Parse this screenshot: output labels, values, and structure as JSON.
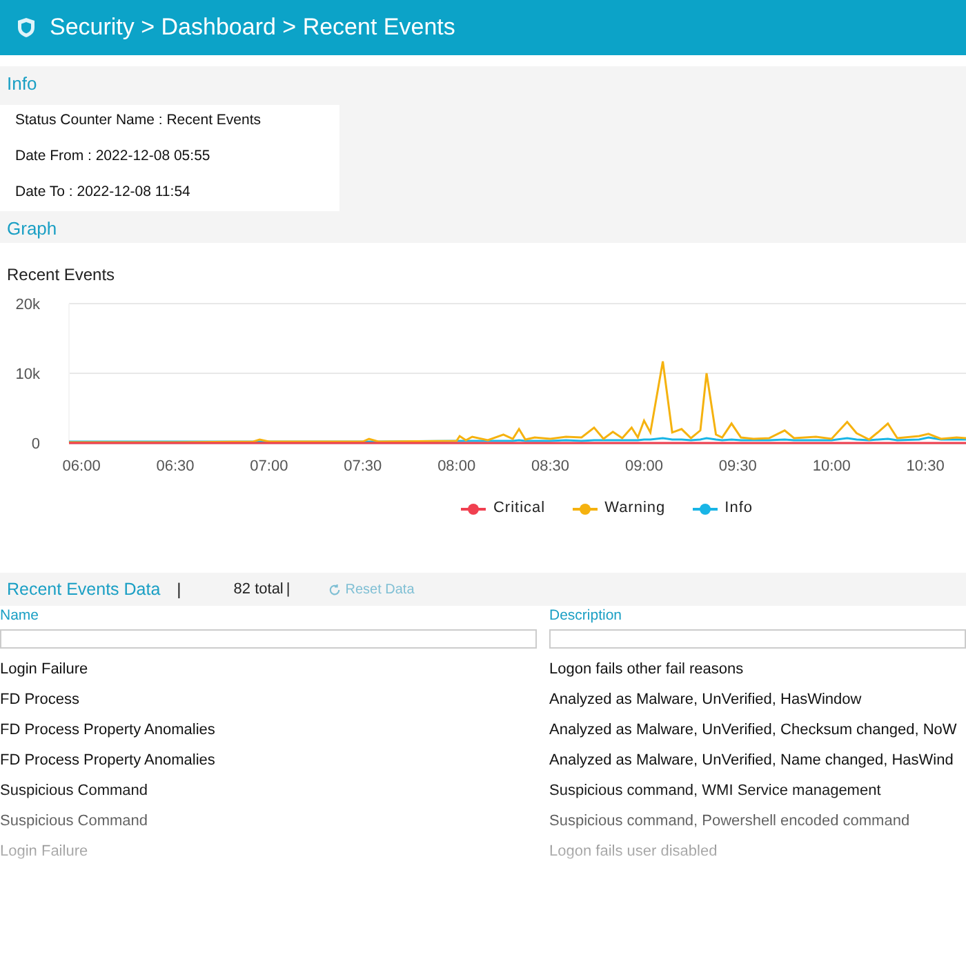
{
  "header": {
    "title": "Security > Dashboard > Recent Events"
  },
  "info": {
    "title": "Info",
    "rows": [
      "Status Counter Name : Recent Events",
      "Date From : 2022-12-08 05:55",
      "Date To : 2022-12-08 11:54"
    ]
  },
  "graph": {
    "title": "Graph",
    "chart_data": {
      "type": "line",
      "title": "Recent Events",
      "legend": "bottom",
      "xlim": [
        356,
        643
      ],
      "x": [
        356,
        390,
        415,
        417,
        420,
        450,
        452,
        455,
        480,
        481,
        483,
        485,
        490,
        495,
        498,
        500,
        502,
        505,
        510,
        515,
        520,
        524,
        527,
        530,
        533,
        536,
        538,
        540,
        542,
        546,
        549,
        552,
        555,
        558,
        560,
        563,
        565,
        568,
        571,
        575,
        580,
        585,
        588,
        595,
        600,
        605,
        608,
        612,
        615,
        618,
        621,
        628,
        631,
        635,
        640,
        643
      ],
      "xticks": [
        {
          "value": 360,
          "label": "06:00"
        },
        {
          "value": 390,
          "label": "06:30"
        },
        {
          "value": 420,
          "label": "07:00"
        },
        {
          "value": 450,
          "label": "07:30"
        },
        {
          "value": 480,
          "label": "08:00"
        },
        {
          "value": 510,
          "label": "08:30"
        },
        {
          "value": 540,
          "label": "09:00"
        },
        {
          "value": 570,
          "label": "09:30"
        },
        {
          "value": 600,
          "label": "10:00"
        },
        {
          "value": 630,
          "label": "10:30"
        }
      ],
      "yticks": [
        {
          "value": 0,
          "label": "0"
        },
        {
          "value": 10000,
          "label": "10k"
        },
        {
          "value": 20000,
          "label": "20k"
        }
      ],
      "ylim": [
        0,
        20000
      ],
      "series": [
        {
          "name": "Critical",
          "color": "#f04050",
          "values": [
            0,
            0,
            0,
            0,
            0,
            0,
            0,
            0,
            0,
            0,
            0,
            0,
            0,
            0,
            0,
            0,
            0,
            0,
            0,
            0,
            0,
            0,
            0,
            0,
            0,
            0,
            0,
            0,
            0,
            0,
            0,
            0,
            0,
            0,
            0,
            0,
            0,
            0,
            0,
            0,
            0,
            0,
            0,
            0,
            0,
            0,
            0,
            0,
            0,
            0,
            0,
            0,
            0,
            0,
            0,
            0
          ]
        },
        {
          "name": "Warning",
          "color": "#f5b20f",
          "values": [
            100,
            100,
            200,
            500,
            200,
            200,
            600,
            200,
            300,
            1000,
            400,
            900,
            400,
            1200,
            600,
            2000,
            500,
            800,
            600,
            900,
            800,
            2200,
            600,
            1600,
            700,
            2200,
            800,
            3200,
            1500,
            11700,
            1500,
            2000,
            700,
            1800,
            10000,
            1200,
            800,
            2800,
            800,
            600,
            700,
            1800,
            700,
            900,
            600,
            3000,
            1400,
            500,
            1600,
            2800,
            700,
            1000,
            1300,
            600,
            800,
            700
          ]
        },
        {
          "name": "Info",
          "color": "#19b5e6",
          "values": [
            200,
            200,
            200,
            200,
            200,
            200,
            200,
            200,
            300,
            300,
            300,
            300,
            300,
            300,
            300,
            400,
            300,
            300,
            300,
            400,
            300,
            400,
            400,
            400,
            400,
            400,
            400,
            500,
            500,
            700,
            500,
            500,
            400,
            500,
            700,
            500,
            400,
            500,
            400,
            400,
            400,
            500,
            400,
            400,
            400,
            700,
            500,
            400,
            500,
            600,
            400,
            500,
            800,
            500,
            500,
            500
          ]
        }
      ]
    }
  },
  "events": {
    "title": "Recent Events Data",
    "divider": "|",
    "total": "82 total",
    "total_divider": "|",
    "reset": {
      "label": "Reset Data",
      "disabled": true
    },
    "columns": [
      {
        "label": "Name"
      },
      {
        "label": "Description"
      }
    ],
    "rows": [
      [
        "Login Failure",
        "Logon fails other fail reasons"
      ],
      [
        "FD Process",
        "Analyzed as Malware, UnVerified, HasWindow"
      ],
      [
        "FD Process Property Anomalies",
        "Analyzed as Malware, UnVerified, Checksum changed, NoW"
      ],
      [
        "FD Process Property Anomalies",
        "Analyzed as Malware, UnVerified, Name changed, HasWind"
      ],
      [
        "Suspicious Command",
        "Suspicious command, WMI Service management"
      ],
      [
        "Suspicious Command",
        "Suspicious command, Powershell encoded command"
      ],
      [
        "Login Failure",
        "Logon fails user disabled"
      ]
    ]
  }
}
